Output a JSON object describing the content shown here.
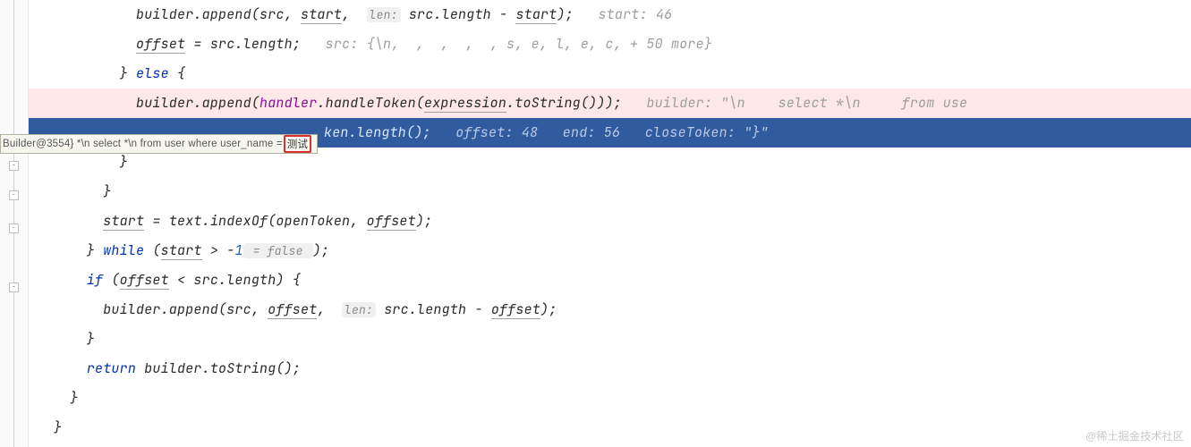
{
  "lines": {
    "l1_pre": "          builder.append(src, ",
    "l1_var1": "start",
    "l1_mid1": ",  ",
    "l1_hint1": "len:",
    "l1_mid2": " src.length - ",
    "l1_var2": "start",
    "l1_post": ");   ",
    "l1_inline": "start: 46",
    "l2_pre": "          ",
    "l2_var": "offset",
    "l2_mid": " = src.length;   ",
    "l2_inline": "src: {\\n,  ,  ,  ,  , s, e, l, e, c, + 50 more}",
    "l3": "        } ",
    "l3_kw": "else",
    "l3_post": " {",
    "l4_pre": "          builder.append(",
    "l4_handler": "handler",
    "l4_mid1": ".handleToken(",
    "l4_expr": "expression",
    "l4_mid2": ".toString()));   ",
    "l4_inline": "builder: \"\\n    select *\\n     from use",
    "l5_visible": "ken.length();   ",
    "l5_inline": "offset: 48   end: 56   closeToken: \"}\"",
    "l6": "        }",
    "l7": "      }",
    "l8_pre": "      ",
    "l8_var1": "start",
    "l8_mid": " = text.indexOf(openToken, ",
    "l8_var2": "offset",
    "l8_post": ");",
    "l9_pre": "    } ",
    "l9_kw": "while",
    "l9_mid1": " (",
    "l9_var": "start",
    "l9_mid2": " > -",
    "l9_num": "1",
    "l9_hint": " = false ",
    "l9_post": ");",
    "l10_pre": "    ",
    "l10_kw": "if",
    "l10_mid1": " (",
    "l10_var": "offset",
    "l10_mid2": " < src.length) {",
    "l11_pre": "      builder.append(src, ",
    "l11_var1": "offset",
    "l11_mid": ",  ",
    "l11_hint": "len:",
    "l11_mid2": " src.length - ",
    "l11_var2": "offset",
    "l11_post": ");",
    "l12": "    }",
    "l13_pre": "    ",
    "l13_kw": "return",
    "l13_post": " builder.toString();",
    "l14": "  }",
    "l15": "}"
  },
  "tooltip": {
    "prefix": "Builder@3554} *\\n    select *\\n    from user where user_name = ",
    "highlight": "测试"
  },
  "watermark": "@稀土掘金技术社区"
}
